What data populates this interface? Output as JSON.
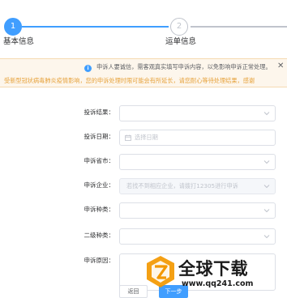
{
  "steps": [
    {
      "number": "1",
      "label": "基本信息"
    },
    {
      "number": "2",
      "label": "运单信息"
    }
  ],
  "notice": {
    "line1": "申诉人要诚信，需客观真实填写申诉内容，以免影响申诉正常处理。",
    "close": "✕",
    "line2": "受新型冠状病毒肺炎疫情影响，您的申诉处理时限可能会有所延长，请您耐心等待处理结果，感谢"
  },
  "form": {
    "result_label": "投诉结果：",
    "result_value": "",
    "date_label": "投诉日期：",
    "date_placeholder": "选择日期",
    "province_label": "申诉省市：",
    "province_value": "",
    "company_label": "申诉企业：",
    "company_placeholder": "若找不到相应企业，请拨打12305进行申诉",
    "type_label": "申诉种类：",
    "type_value": "",
    "subtype_label": "二级种类：",
    "subtype_value": "",
    "reason_label": "申诉原因：",
    "reason_value": ""
  },
  "buttons": {
    "back": "返回",
    "next": "下一步"
  },
  "watermark": {
    "title": "全球下载",
    "url": "www.qq241.com"
  },
  "colors": {
    "primary": "#409eff",
    "warning": "#e6a23c",
    "notice_bg": "#fdf6ec",
    "watermark_orange": "#f39800"
  }
}
